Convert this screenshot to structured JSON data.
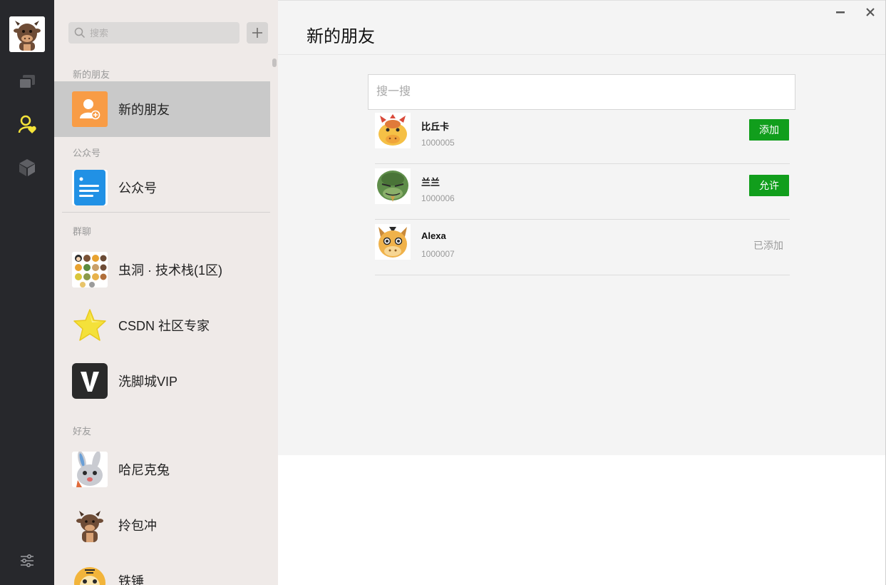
{
  "app": {
    "accent": "#119e1c",
    "nav_active_color": "#f5e43a"
  },
  "nav": {
    "avatar_icon": "ox-avatar",
    "items": [
      {
        "icon": "chat-bubbles-icon",
        "active": false
      },
      {
        "icon": "friends-icon",
        "active": true
      },
      {
        "icon": "cube-icon",
        "active": false
      }
    ],
    "settings_icon": "sliders-icon"
  },
  "sidebar": {
    "search_placeholder": "搜索",
    "add_icon": "plus-icon",
    "sections": {
      "new_friends": "新的朋友",
      "official": "公众号",
      "groups": "群聊",
      "friends": "好友"
    },
    "new_friends_item": "新的朋友",
    "official_item": "公众号",
    "groups": [
      {
        "label": "虫洞 · 技术栈(1区)",
        "icon": "group-mosaic"
      },
      {
        "label": "CSDN 社区专家",
        "icon": "star"
      },
      {
        "label": "洗脚城VIP",
        "icon": "letter-v"
      }
    ],
    "friends": [
      {
        "label": "哈尼克兔",
        "icon": "rabbit-avatar"
      },
      {
        "label": "拎包冲",
        "icon": "ox-avatar"
      },
      {
        "label": "铁锤",
        "icon": "tiger-avatar"
      }
    ]
  },
  "main": {
    "title": "新的朋友",
    "search_placeholder": "搜一搜",
    "friend_requests": [
      {
        "name": "比丘卡",
        "id": "1000005",
        "action": "添加",
        "avatar": "red-dragon-avatar"
      },
      {
        "name": "兰兰",
        "id": "1000006",
        "action": "允许",
        "avatar": "green-dino-avatar"
      },
      {
        "name": "Alexa",
        "id": "1000007",
        "status": "已添加",
        "avatar": "horse-avatar"
      }
    ]
  }
}
